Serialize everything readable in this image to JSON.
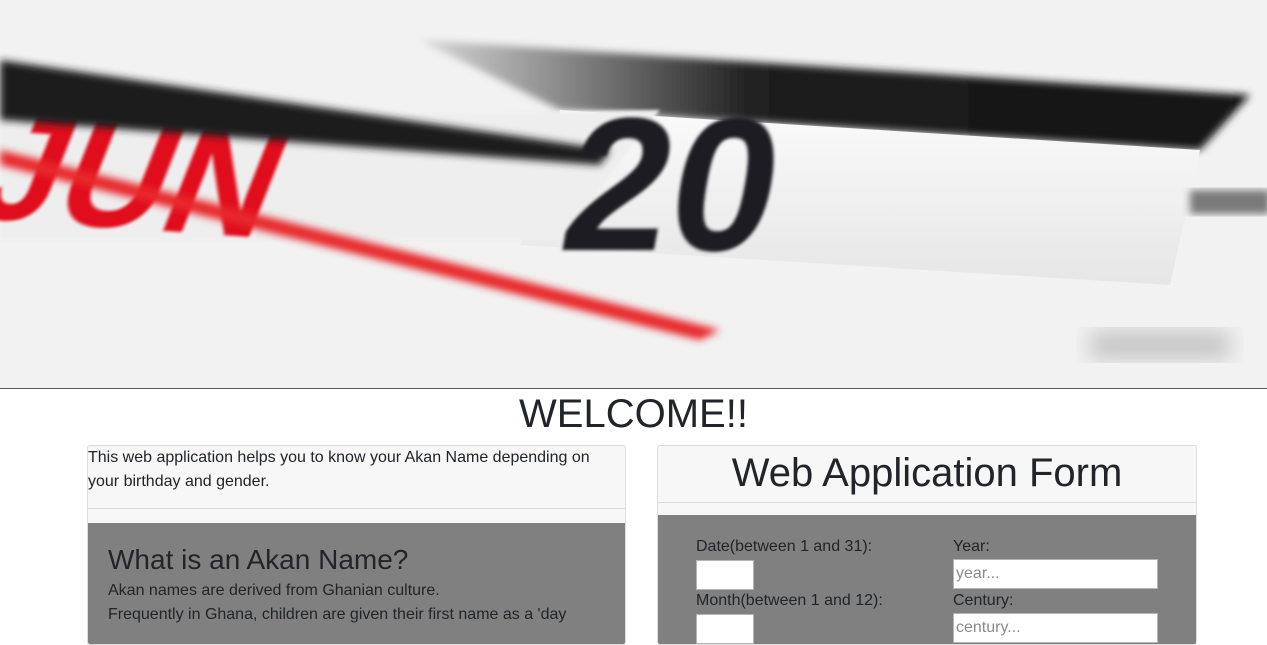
{
  "hero": {
    "image_alt": "calendar",
    "month_text": "JUN",
    "day_text": "20"
  },
  "welcome": "WELCOME!!",
  "info": {
    "intro": "This web application helps you to know your Akan Name depending on your birthday and gender.",
    "heading": "What is an Akan Name?",
    "desc_line1": "Akan names are derived from Ghanian culture.",
    "desc_line2": "Frequently in Ghana, children are given their first name as a 'day"
  },
  "form": {
    "title": "Web Application Form",
    "date_label": "Date(between 1 and 31):",
    "month_label": "Month(between 1 and 12):",
    "year_label": "Year:",
    "year_placeholder": "year...",
    "century_label": "Century:",
    "century_placeholder": "century..."
  },
  "colors": {
    "panel_grey": "#808080",
    "card_bg": "#f7f7f7",
    "calendar_red": "#e0101a"
  }
}
